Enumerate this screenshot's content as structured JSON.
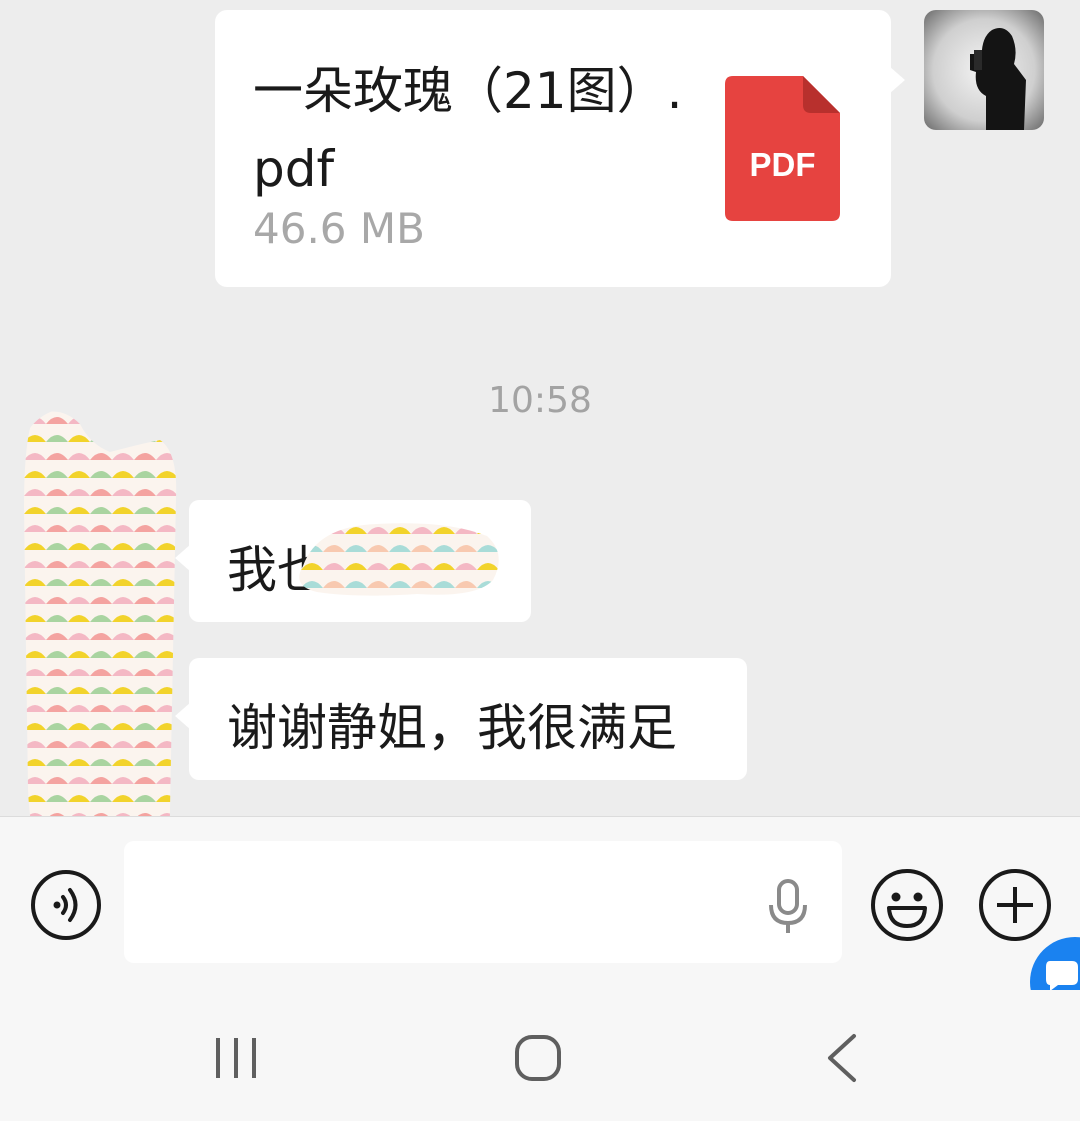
{
  "messages": {
    "outgoing_file": {
      "file_name": "一朵玫瑰（21图）.pdf",
      "file_size": "46.6 MB",
      "icon": "pdf-file-icon",
      "icon_label": "PDF"
    },
    "timestamp": "10:58",
    "incoming": [
      {
        "text": "我也"
      },
      {
        "text": "谢谢静姐，我很满足"
      }
    ]
  },
  "input_bar": {
    "text_value": "",
    "icons": [
      "voice-mode-icon",
      "microphone-icon",
      "emoji-icon",
      "plus-icon"
    ]
  },
  "floating_button": {
    "icon": "chat-bubble-icon"
  },
  "nav_bar": {
    "icons": [
      "recents-icon",
      "home-icon",
      "back-icon"
    ]
  },
  "colors": {
    "background": "#ededed",
    "bubble": "#ffffff",
    "pdf_red": "#e64340",
    "secondary_text": "#a8a8a8",
    "timestamp": "#a3a3a3",
    "accent_blue": "#1a82f0"
  }
}
